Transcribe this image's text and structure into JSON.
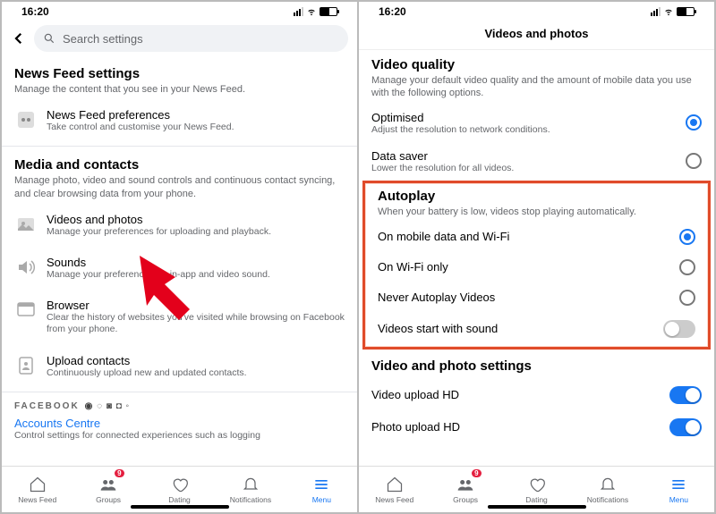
{
  "status": {
    "time": "16:20"
  },
  "left": {
    "search_placeholder": "Search settings",
    "section_news": {
      "title": "News Feed settings",
      "desc": "Manage the content that you see in your News Feed."
    },
    "pref": {
      "title": "News Feed preferences",
      "desc": "Take control and customise your News Feed."
    },
    "section_media": {
      "title": "Media and contacts",
      "desc": "Manage photo, video and sound controls and continuous contact syncing, and clear browsing data from your phone."
    },
    "videos": {
      "title": "Videos and photos",
      "desc": "Manage your preferences for uploading and playback."
    },
    "sounds": {
      "title": "Sounds",
      "desc": "Manage your preferences for in-app and video sound."
    },
    "browser": {
      "title": "Browser",
      "desc": "Clear the history of websites you've visited while browsing on Facebook from your phone."
    },
    "upload": {
      "title": "Upload contacts",
      "desc": "Continuously upload new and updated contacts."
    },
    "fblogo": "FACEBOOK",
    "acct": {
      "title": "Accounts Centre",
      "desc": "Control settings for connected experiences such as logging"
    }
  },
  "right": {
    "header": "Videos and photos",
    "vq": {
      "title": "Video quality",
      "desc": "Manage your default video quality and the amount of mobile data you use with the following options."
    },
    "optimised": {
      "label": "Optimised",
      "desc": "Adjust the resolution to network conditions."
    },
    "datasaver": {
      "label": "Data saver",
      "desc": "Lower the resolution for all videos."
    },
    "autoplay": {
      "title": "Autoplay",
      "desc": "When your battery is low, videos stop playing automatically."
    },
    "ap1": "On mobile data and Wi-Fi",
    "ap2": "On Wi-Fi only",
    "ap3": "Never Autoplay Videos",
    "ap4": "Videos start with sound",
    "vps": {
      "title": "Video and photo settings"
    },
    "vhd": "Video upload HD",
    "phd": "Photo upload HD"
  },
  "tabs": {
    "newsfeed": "News Feed",
    "groups": "Groups",
    "dating": "Dating",
    "notif": "Notifications",
    "menu": "Menu",
    "badge": "9"
  }
}
